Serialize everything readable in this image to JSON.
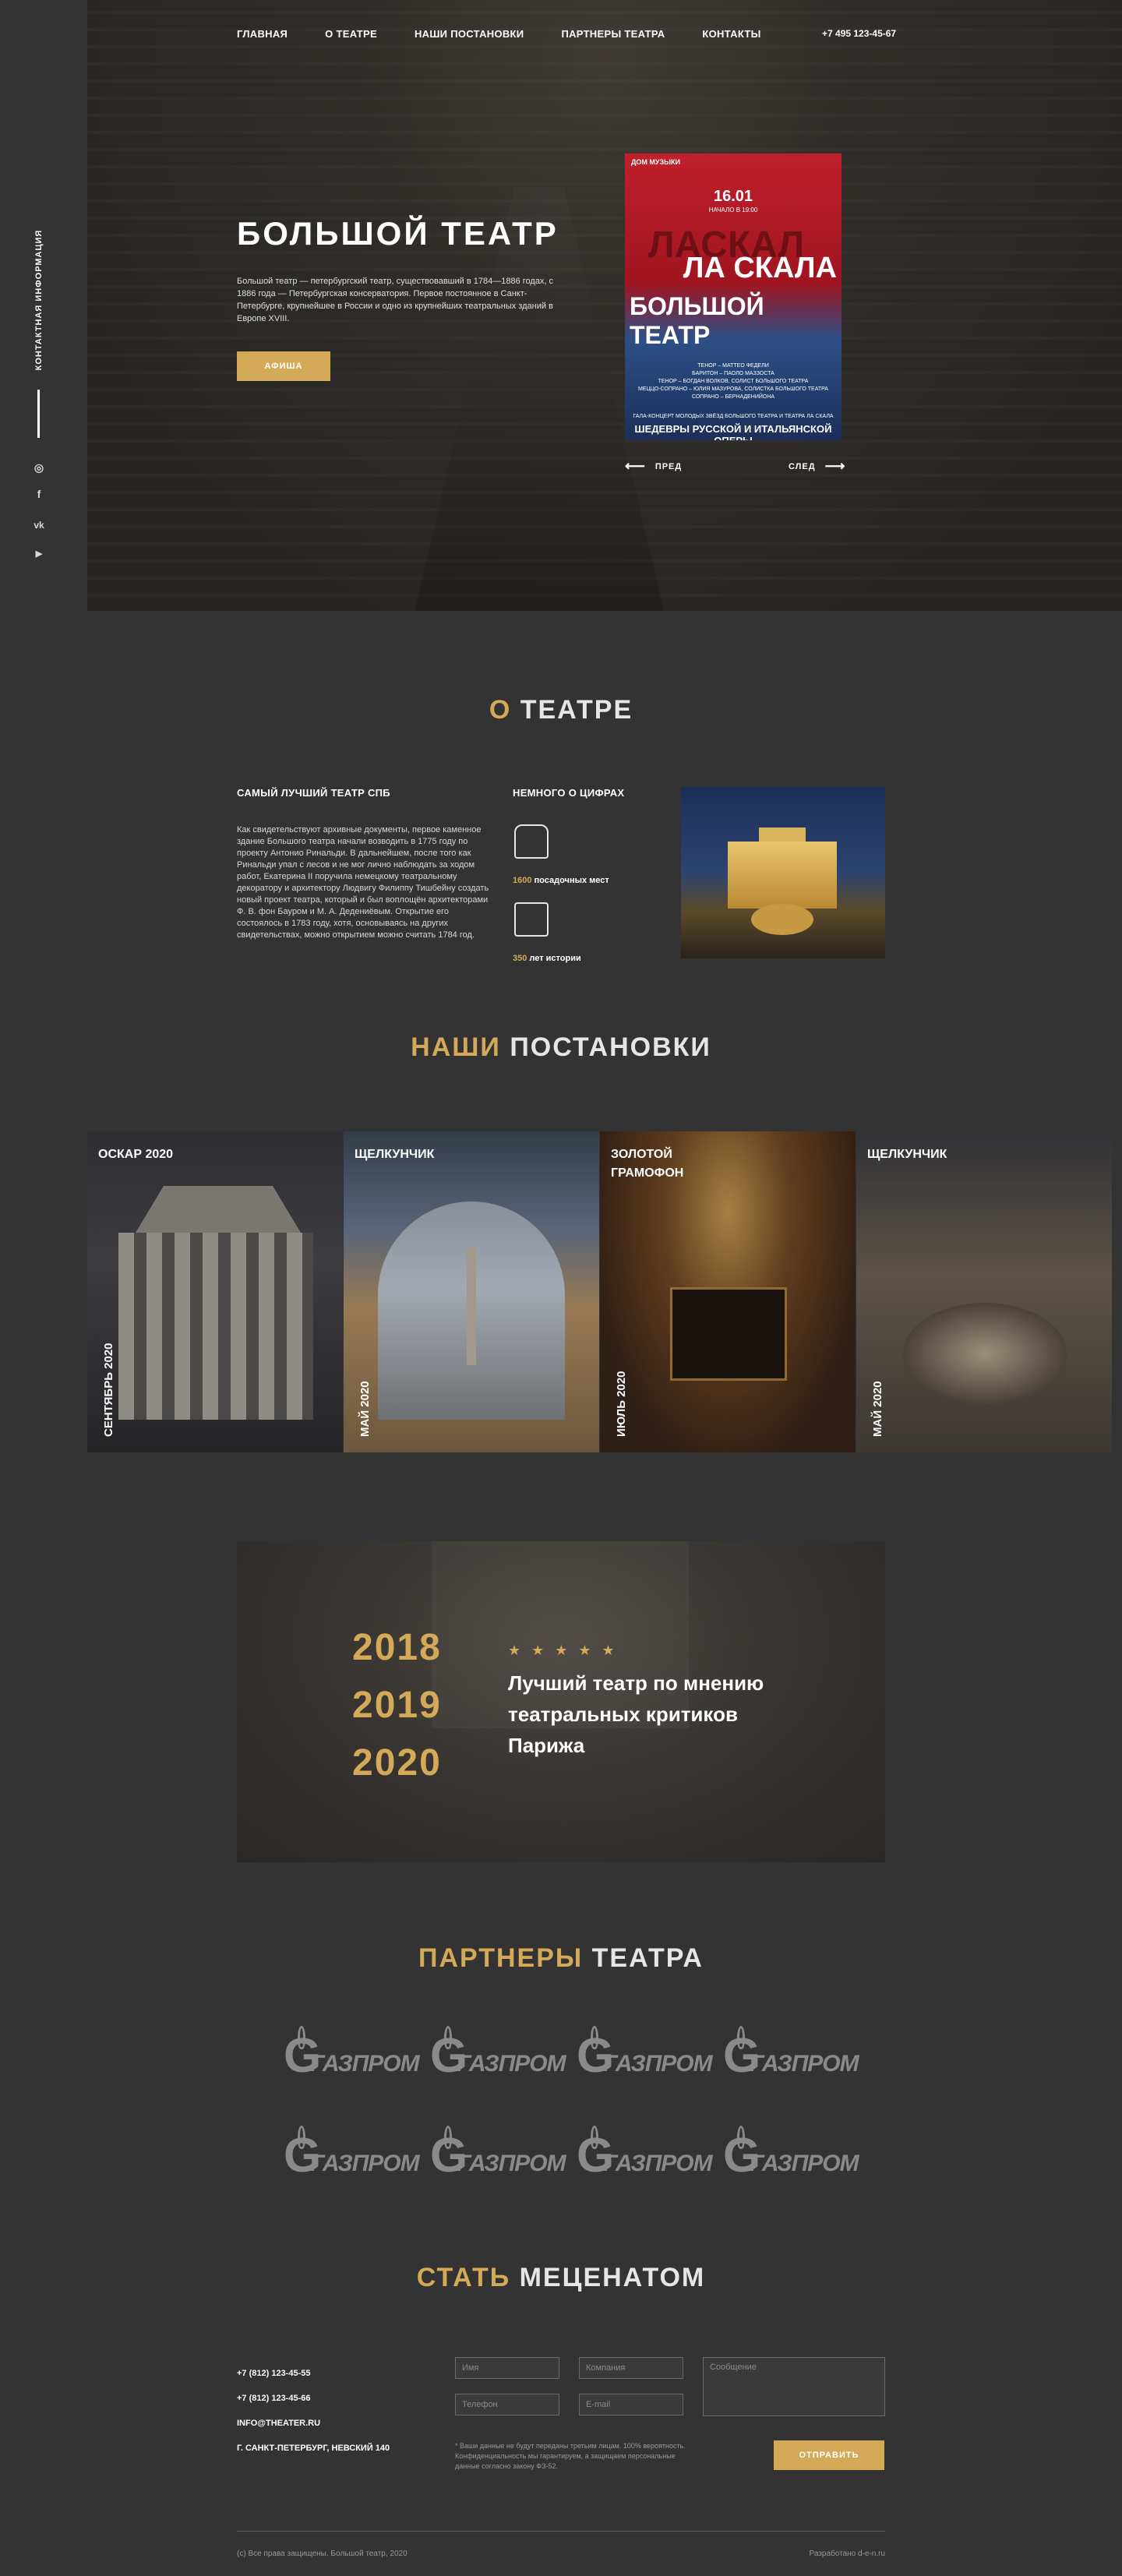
{
  "nav": {
    "items": [
      "ГЛАВНАЯ",
      "О ТЕАТРЕ",
      "НАШИ ПОСТАНОВКИ",
      "ПАРТНЕРЫ ТЕАТРА",
      "КОНТАКТЫ"
    ],
    "phone": "+7 495 123-45-67"
  },
  "sidebar": {
    "contact_label": "КОНТАКТНАЯ ИНФОРМАЦИЯ",
    "social": [
      {
        "icon": "instagram-icon",
        "glyph": "◎"
      },
      {
        "icon": "facebook-icon",
        "glyph": "f"
      },
      {
        "icon": "vk-icon",
        "glyph": "vk"
      },
      {
        "icon": "youtube-icon",
        "glyph": "▶"
      }
    ]
  },
  "hero": {
    "title": "БОЛЬШОЙ ТЕАТР",
    "text": "Большой театр — петербургский театр, существовавший в 1784—1886 годах, с 1886 года — Петербургская консерватория. Первое постоянное в Санкт-Петербурге, крупнейшее в России и одно из крупнейших театральных зданий в Европе XVIII.",
    "button": "АФИША",
    "prev": "ПРЕД",
    "next": "СЛЕД"
  },
  "poster": {
    "logo": "ДОМ МУЗЫКИ",
    "date": "16.01",
    "time": "НАЧАЛО В 19:00",
    "ghost": "ЛАСКАЛ",
    "title1": "ЛА СКАЛА",
    "title2": "БОЛЬШОЙ ТЕАТР",
    "cast": "ТЕНОР – МАТТЕО ФЕДЕЛИ\nБАРИТОН – ПАОЛО МАЗЗОСТА\nТЕНОР – БОГДАН ВОЛКОВ, СОЛИСТ БОЛЬШОГО ТЕАТРА\nМЕЦЦО-СОПРАНО – ЮЛИЯ МАЗУРОВА, СОЛИСТКА БОЛЬШОГО ТЕАТРА\nСОПРАНО – БЕРНАДЕНИЙОНА",
    "gala": "ГАЛА-КОНЦЕРТ МОЛОДЫХ ЗВЁЗД БОЛЬШОГО ТЕАТРА И ТЕАТРА ЛА СКАЛА",
    "bottom": "ШЕДЕВРЫ РУССКОЙ И ИТАЛЬЯНСКОЙ ОПЕРЫ"
  },
  "about": {
    "title_accent": "О",
    "title_rest": " ТЕАТРЕ",
    "col1_title": "САМЫЙ ЛУЧШИЙ ТЕАТР СПБ",
    "col1_text": "Как свидетельствуют архивные документы, первое каменное здание Большого театра начали возводить в 1775 году по проекту Антонио Ринальди. В дальнейшем, после того как Ринальди упал с лесов и не мог лично наблюдать за ходом работ, Екатерина II поручила немецкому театральному декоратору и архитектору Людвигу Филиппу Тишбейну создать новый проект театра, который и был воплощён архитекторами Ф. В. фон Бауром и М. А. Дедениёвым. Открытие его состоялось в 1783 году, хотя, основываясь на других свидетельствах, можно открытием можно считать 1784 год.",
    "col2_title": "НЕМНОГО О ЦИФРАХ",
    "stats": [
      {
        "value": "1600",
        "label": " посадочных мест",
        "icon": "seat-icon"
      },
      {
        "value": "350",
        "label": " лет истории",
        "icon": "stage-icon"
      }
    ]
  },
  "productions": {
    "title_accent": "НАШИ",
    "title_rest": " ПОСТАНОВКИ",
    "items": [
      {
        "name": "ОСКАР 2020",
        "date": "СЕНТЯБРЬ 2020"
      },
      {
        "name": "ЩЕЛКУНЧИК",
        "date": "МАЙ 2020"
      },
      {
        "name": "ЗОЛОТОЙ ГРАМОФОН",
        "date": "ИЮЛЬ 2020"
      },
      {
        "name": "ЩЕЛКУНЧИК",
        "date": "МАЙ 2020"
      }
    ]
  },
  "award": {
    "years": [
      "2018",
      "2019",
      "2020"
    ],
    "stars": "★★★★★",
    "text": "Лучший театр по мнению театральных критиков Парижа"
  },
  "partners": {
    "title_accent": "ПАРТНЕРЫ",
    "title_rest": " ТЕАТРА",
    "logo_letter": "G",
    "logo_name": "ГАЗПРОМ"
  },
  "patron": {
    "title_accent": "СТАТЬ",
    "title_rest": " МЕЦЕНАТОМ",
    "contacts": [
      "+7 (812) 123-45-55",
      "+7 (812) 123-45-66",
      "INFO@THEATER.RU",
      "Г. САНКТ-ПЕТЕРБУРГ, НЕВСКИЙ 140"
    ],
    "form": {
      "name_placeholder": "Имя",
      "company_placeholder": "Компания",
      "message_placeholder": "Сообщение",
      "phone_placeholder": "Телефон",
      "email_placeholder": "E-mail",
      "disclaimer": "* Ваши данные не будут переданы третьим лицам. 100% вероятность. Конфиденциальность мы гарантируем, а защищаем персональные данные согласно закону ФЗ-52.",
      "submit": "ОТПРАВИТЬ"
    }
  },
  "footer": {
    "copyright": "(с) Все права защищены. Большой театр, 2020",
    "developer": "Разработано d-e-n.ru"
  }
}
